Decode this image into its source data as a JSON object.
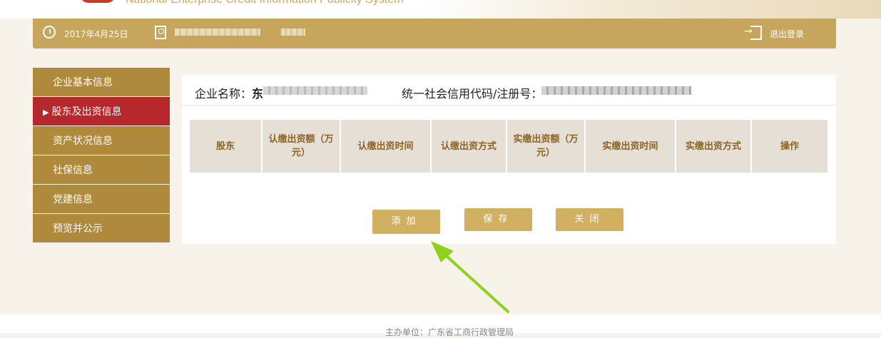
{
  "banner": {
    "english_name": "National Enterprise Credit Information Publicity System"
  },
  "userbar": {
    "date": "2017年4月25日",
    "logout_label": "退出登录"
  },
  "sidebar": {
    "items": [
      {
        "label": "企业基本信息"
      },
      {
        "label": "股东及出资信息",
        "active": true
      },
      {
        "label": "资产状况信息"
      },
      {
        "label": "社保信息"
      },
      {
        "label": "党建信息"
      },
      {
        "label": "预览并公示"
      }
    ],
    "active_marker": "▶"
  },
  "panel": {
    "company_label": "企业名称：",
    "company_name_visible": "东",
    "credit_code_label": "统一社会信用代码/注册号："
  },
  "table": {
    "headers": [
      "股东",
      "认缴出资额（万元）",
      "认缴出资时间",
      "认缴出资方式",
      "实缴出资额（万元）",
      "实缴出资时间",
      "实缴出资方式",
      "操作"
    ]
  },
  "buttons": {
    "add": "添加",
    "save": "保存",
    "close": "关闭"
  },
  "colors": {
    "gold": "#c8a55c",
    "sidebar": "#b08a3c",
    "active": "#b7282c",
    "arrow": "#8fd11c"
  },
  "footer": {
    "text": "主办单位：广东省工商行政管理局"
  }
}
